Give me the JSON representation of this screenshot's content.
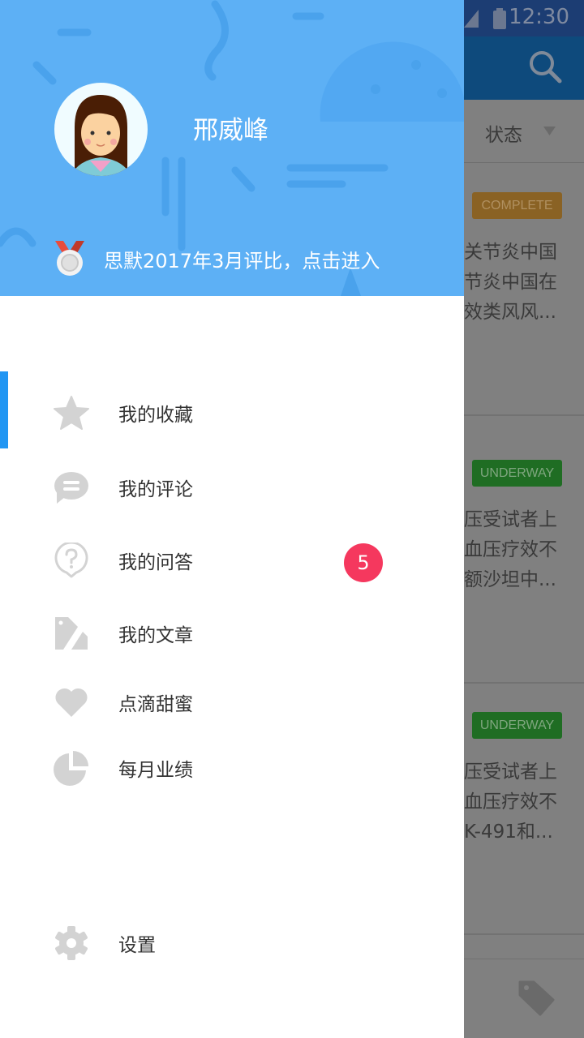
{
  "status_bar": {
    "time": "12:30"
  },
  "background": {
    "filter_label": "状态",
    "cards": [
      {
        "status": "COMPLETE",
        "status_color": "#8a6224",
        "lines": [
          "关节炎中国",
          "节炎中国在",
          "效类风风..."
        ]
      },
      {
        "status": "UNDERWAY",
        "status_color": "#1f6d23",
        "lines": [
          "压受试者上",
          "血压疗效不",
          "额沙坦中..."
        ]
      },
      {
        "status": "UNDERWAY",
        "status_color": "#1f6d23",
        "lines": [
          "压受试者上",
          "血压疗效不",
          "K-491和..."
        ]
      }
    ]
  },
  "drawer": {
    "user_name": "邢威峰",
    "award_text": "思默2017年3月评比，点击进入",
    "header_color": "#5db0f5",
    "items": [
      {
        "label": "我的收藏",
        "icon": "star-icon",
        "active": true
      },
      {
        "label": "我的评论",
        "icon": "comment-icon"
      },
      {
        "label": "我的问答",
        "icon": "question-icon",
        "badge": "5"
      },
      {
        "label": "我的文章",
        "icon": "article-icon"
      },
      {
        "label": "点滴甜蜜",
        "icon": "heart-icon"
      },
      {
        "label": "每月业绩",
        "icon": "pie-chart-icon"
      }
    ],
    "settings_label": "设置",
    "badge_color": "#f5385e",
    "accent": "#2196f3"
  }
}
